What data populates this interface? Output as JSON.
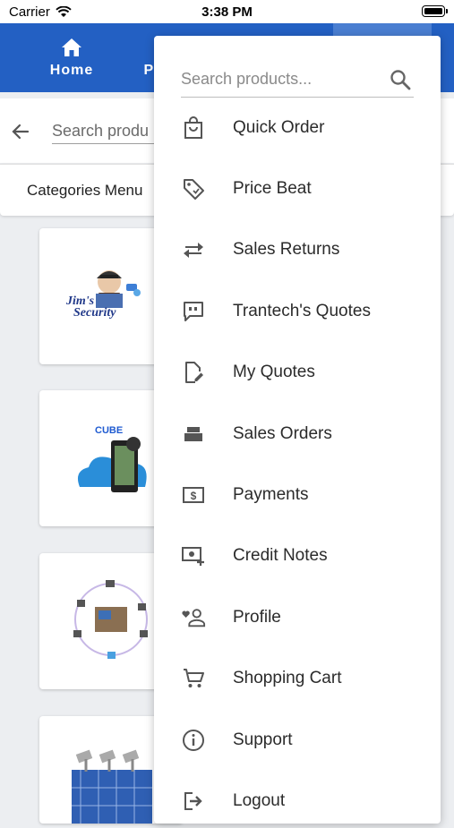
{
  "status_bar": {
    "carrier": "Carrier",
    "time": "3:38 PM"
  },
  "top_nav": {
    "tabs": [
      {
        "label": "Home",
        "icon": "home-icon"
      },
      {
        "label": "Pr",
        "icon": "products-icon"
      }
    ]
  },
  "search_bar": {
    "placeholder": "Search produ"
  },
  "categories": {
    "label": "Categories Menu"
  },
  "product_cards": [
    {
      "logo_text_1": "Jim's",
      "logo_text_2": "Security"
    },
    {
      "logo_text": "CUBE"
    },
    {
      "name": "network-diagram"
    },
    {
      "name": "solar-lights"
    }
  ],
  "drawer": {
    "search_placeholder": "Search products...",
    "items": [
      {
        "label": "Quick Order",
        "icon": "shopping-bag-icon"
      },
      {
        "label": "Price Beat",
        "icon": "price-tag-icon"
      },
      {
        "label": "Sales Returns",
        "icon": "swap-arrows-icon"
      },
      {
        "label": "Trantech's Quotes",
        "icon": "quote-bubble-icon"
      },
      {
        "label": "My Quotes",
        "icon": "edit-document-icon"
      },
      {
        "label": "Sales Orders",
        "icon": "order-box-icon"
      },
      {
        "label": "Payments",
        "icon": "dollar-bill-icon"
      },
      {
        "label": "Credit Notes",
        "icon": "credit-note-icon"
      },
      {
        "label": "Profile",
        "icon": "profile-heart-icon"
      },
      {
        "label": "Shopping Cart",
        "icon": "cart-icon"
      },
      {
        "label": "Support",
        "icon": "info-icon"
      },
      {
        "label": "Logout",
        "icon": "logout-icon"
      }
    ]
  },
  "colors": {
    "primary": "#2360c3",
    "active_tab": "#4a7ed1",
    "background": "#eceef1"
  }
}
